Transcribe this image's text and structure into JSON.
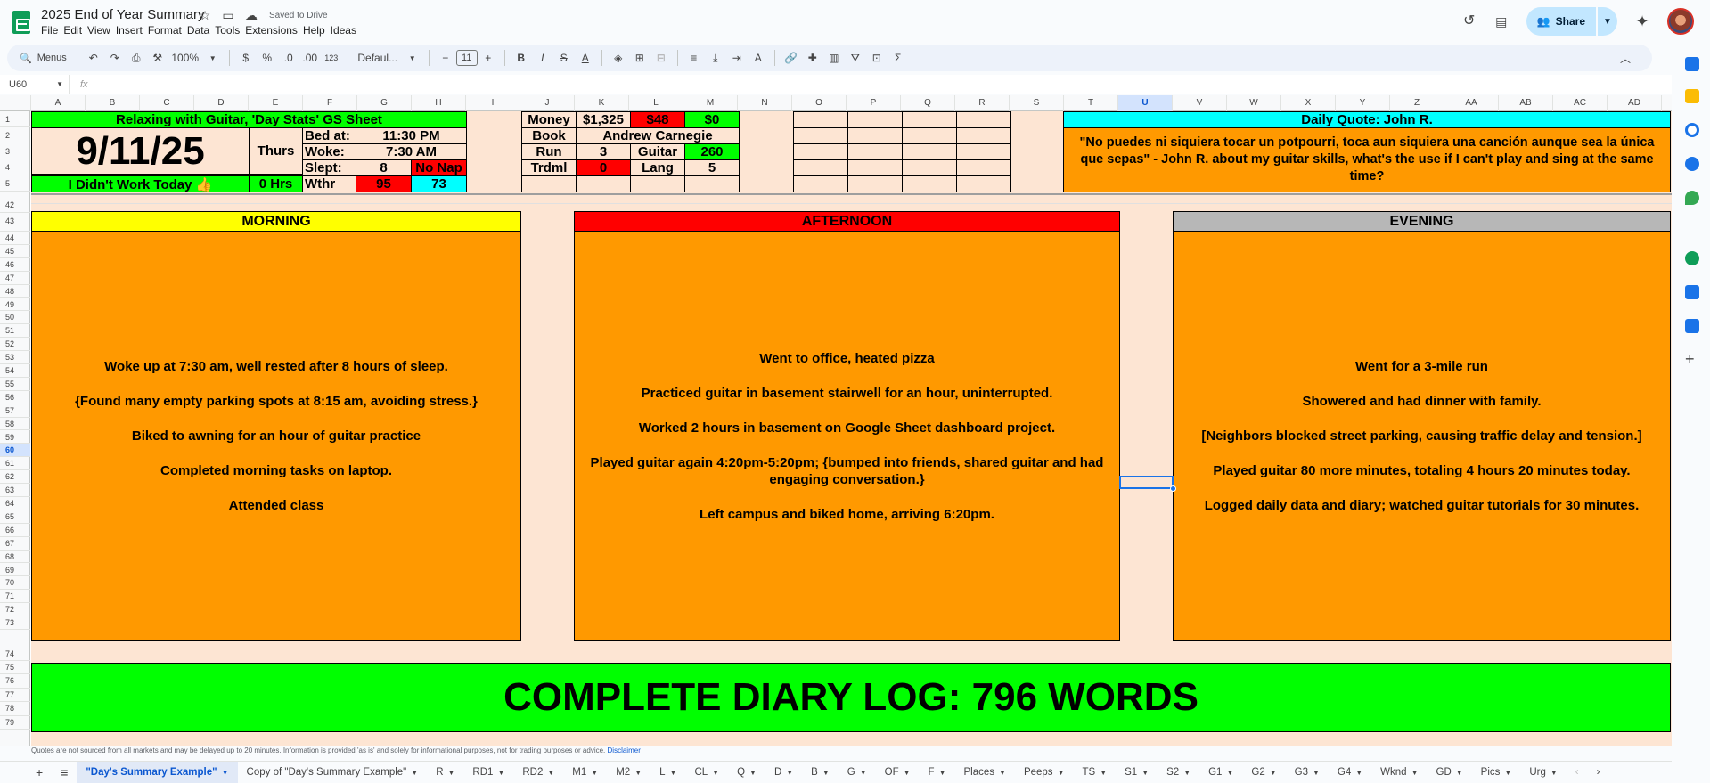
{
  "doc": {
    "title": "2025 End of Year Summary",
    "saved_status": "Saved to Drive",
    "menu": [
      "File",
      "Edit",
      "View",
      "Insert",
      "Format",
      "Data",
      "Tools",
      "Extensions",
      "Help",
      "Ideas"
    ],
    "share_label": "Share"
  },
  "toolbar": {
    "menus_label": "Menus",
    "zoom": "100%",
    "currency": "$",
    "percent": "%",
    "dec_decrease": ".0",
    "dec_increase": ".00",
    "number_format": "123",
    "font": "Defaul...",
    "font_size": "11"
  },
  "formula": {
    "cell_ref": "U60",
    "fx": "fx"
  },
  "columns": [
    "A",
    "B",
    "C",
    "D",
    "E",
    "F",
    "G",
    "H",
    "I",
    "J",
    "K",
    "L",
    "M",
    "N",
    "O",
    "P",
    "Q",
    "R",
    "S",
    "T",
    "U",
    "V",
    "W",
    "X",
    "Y",
    "Z",
    "AA",
    "AB",
    "AC",
    "AD"
  ],
  "rows_top": [
    "1",
    "2",
    "3",
    "4",
    "5"
  ],
  "rows_mid": [
    "42",
    "43",
    "44",
    "45",
    "46",
    "47",
    "48",
    "49",
    "50",
    "51",
    "52",
    "53",
    "54",
    "55",
    "56",
    "57",
    "58",
    "59",
    "60",
    "61",
    "62",
    "63",
    "64",
    "65",
    "66",
    "67",
    "68",
    "69",
    "70",
    "71",
    "72",
    "73"
  ],
  "rows_bottom": [
    "74",
    "75",
    "76",
    "77",
    "78",
    "79"
  ],
  "stats": {
    "header": "Relaxing with Guitar, 'Day Stats' GS Sheet",
    "date": "9/11/25",
    "weekday": "Thurs",
    "bed_label": "Bed at:",
    "bed_value": "11:30 PM",
    "woke_label": "Woke:",
    "woke_value": "7:30 AM",
    "slept_label": "Slept:",
    "slept_value": "8",
    "nap": "No Nap",
    "work_status": "I Didn't Work Today 👍",
    "work_hours": "0 Hrs",
    "weather_label": "Wthr",
    "weather_high": "95",
    "weather_low": "73"
  },
  "money": {
    "money_label": "Money",
    "money_value": "$1,325",
    "spent": "$48",
    "other": "$0",
    "book_label": "Book",
    "book_value": "Andrew Carnegie",
    "run_label": "Run",
    "run_value": "3",
    "guitar_label": "Guitar",
    "guitar_value": "260",
    "trdml_label": "Trdml",
    "trdml_value": "0",
    "lang_label": "Lang",
    "lang_value": "5"
  },
  "quote": {
    "header": "Daily Quote: John R.",
    "text": "\"No puedes ni siquiera tocar un potpourri, toca aun siquiera una canción aunque sea la única que sepas\" - John R. about my guitar skills, what's the use if I can't play and sing at the same time?"
  },
  "morning": {
    "header": "MORNING",
    "lines": [
      "Woke up at 7:30 am, well rested after 8 hours of sleep.",
      "{Found many empty parking spots at 8:15 am, avoiding stress.}",
      "Biked to awning for an hour of guitar practice",
      "Completed morning tasks on laptop.",
      "Attended class"
    ]
  },
  "afternoon": {
    "header": "AFTERNOON",
    "lines": [
      "Went to office, heated pizza",
      "Practiced guitar in basement stairwell for an hour, uninterrupted.",
      "Worked 2 hours in basement on Google Sheet dashboard project.",
      "Played guitar again 4:20pm-5:20pm; {bumped into friends, shared guitar and had engaging conversation.}",
      "Left campus and biked home, arriving 6:20pm."
    ]
  },
  "evening": {
    "header": "EVENING",
    "lines": [
      "Went for a 3-mile run",
      "Showered and had dinner with family.",
      "[Neighbors blocked street parking, causing traffic delay and tension.]",
      "Played guitar 80 more minutes, totaling 4 hours 20 minutes today.",
      "Logged daily data and diary; watched guitar tutorials for 30 minutes."
    ]
  },
  "diary": {
    "banner": "COMPLETE DIARY LOG: 796 WORDS"
  },
  "notice": {
    "text": "Quotes are not sourced from all markets and may be delayed up to 20 minutes. Information is provided 'as is' and solely for informational purposes, not for trading purposes or advice.",
    "link": "Disclaimer"
  },
  "tabs": [
    "\"Day's Summary Example\"",
    "Copy of \"Day's Summary Example\"",
    "R",
    "RD1",
    "RD2",
    "M1",
    "M2",
    "L",
    "CL",
    "Q",
    "D",
    "B",
    "G",
    "OF",
    "F",
    "Places",
    "Peeps",
    "TS",
    "S1",
    "S2",
    "G1",
    "G2",
    "G3",
    "G4",
    "Wknd",
    "GD",
    "Pics",
    "Urg"
  ],
  "colors": {
    "green": "#00ff00",
    "red": "#ff0000",
    "cyan": "#00ffff",
    "orange": "#ff9900",
    "yellow": "#ffff00",
    "gray": "#b7b7b7",
    "peach": "#fde5d3"
  }
}
